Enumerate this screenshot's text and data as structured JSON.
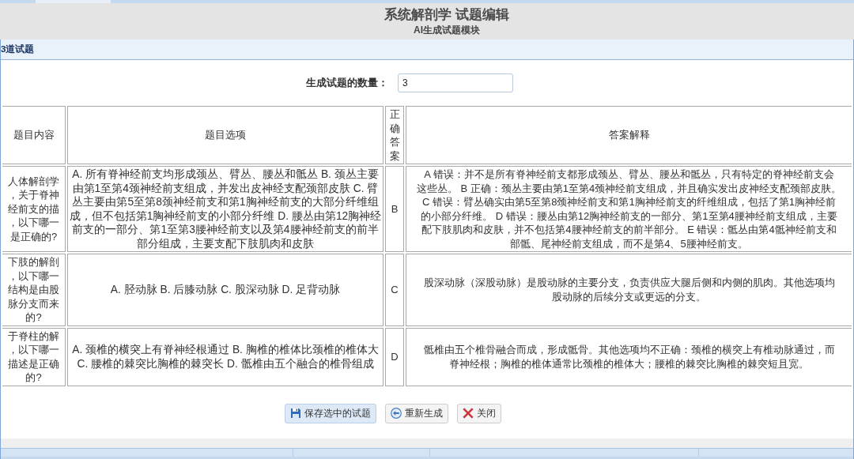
{
  "header": {
    "title": "系统解剖学 试题编辑",
    "subtitle": "AI生成试题模块"
  },
  "section": {
    "title": "3道试题"
  },
  "quantity": {
    "label": "生成试题的数量：",
    "value": "3"
  },
  "table": {
    "columns": [
      "题目内容",
      "题目选项",
      "正确答案",
      "答案解释"
    ],
    "rows": [
      {
        "question": "人体解剖学，关于脊神经前支的描，以下哪一是正确的?",
        "options": "A. 所有脊神经前支均形成颈丛、臂丛、腰丛和骶丛 B. 颈丛主要由第1至第4颈神经前支组成，并发出皮神经支配颈部皮肤 C. 臂丛主要由第5至第8颈神经前支和第1胸神经前支的大部分纤维组成，但不包括第1胸神经前支的小部分纤维 D. 腰丛由第12胸神经前支的一部分、第1至第3腰神经前支以及第4腰神经前支的前半部分组成，主要支配下肢肌肉和皮肤",
        "answer": "B",
        "explanation": [
          "A 错误：并不是所有脊神经前支都形成颈丛、臂丛、腰丛和骶丛，只有特定的脊神经前支会",
          "这些丛。 B 正确：颈丛主要由第1至第4颈神经前支组成，并且确实发出皮神经支配颈部皮肤。",
          "C 错误：臂丛确实由第5至第8颈神经前支和第1胸神经前支的纤维组成，包括了第1胸神经前",
          "的小部分纤维。 D 错误：腰丛由第12胸神经前支的一部分、第1至第4腰神经前支组成，主要",
          "配下肢肌肉和皮肤，并不包括第4腰神经前支的前半部分。 E 错误：骶丛由第4骶神经前支和",
          "部骶、尾神经前支组成，而不是第4、5腰神经前支。"
        ]
      },
      {
        "question": "下肢的解剖，以下哪一结构是由股脉分支而来的?",
        "options": "A. 胫动脉 B. 后膝动脉 C. 股深动脉 D. 足背动脉",
        "answer": "C",
        "explanation": [
          "股深动脉（深股动脉）是股动脉的主要分支，负责供应大腿后侧和内侧的肌肉。其他选项均",
          "股动脉的后续分支或更远的分支。"
        ]
      },
      {
        "question": "于脊柱的解，以下哪一描述是正确的?",
        "options": "A. 颈椎的横突上有脊神经根通过 B. 胸椎的椎体比颈椎的椎体大 C. 腰椎的棘突比胸椎的棘突长 D. 骶椎由五个融合的椎骨组成",
        "answer": "D",
        "explanation": [
          "骶椎由五个椎骨融合而成，形成骶骨。其他选项均不正确：颈椎的横突上有椎动脉通过，而",
          "脊神经根；胸椎的椎体通常比颈椎的椎体大；腰椎的棘突比胸椎的棘突短且宽。"
        ]
      }
    ]
  },
  "buttons": [
    {
      "kind": "save",
      "label": "保存选中的试题",
      "focused": true
    },
    {
      "kind": "regenerate",
      "label": "重新生成",
      "focused": false
    },
    {
      "kind": "close",
      "label": "关闭",
      "focused": false
    }
  ]
}
